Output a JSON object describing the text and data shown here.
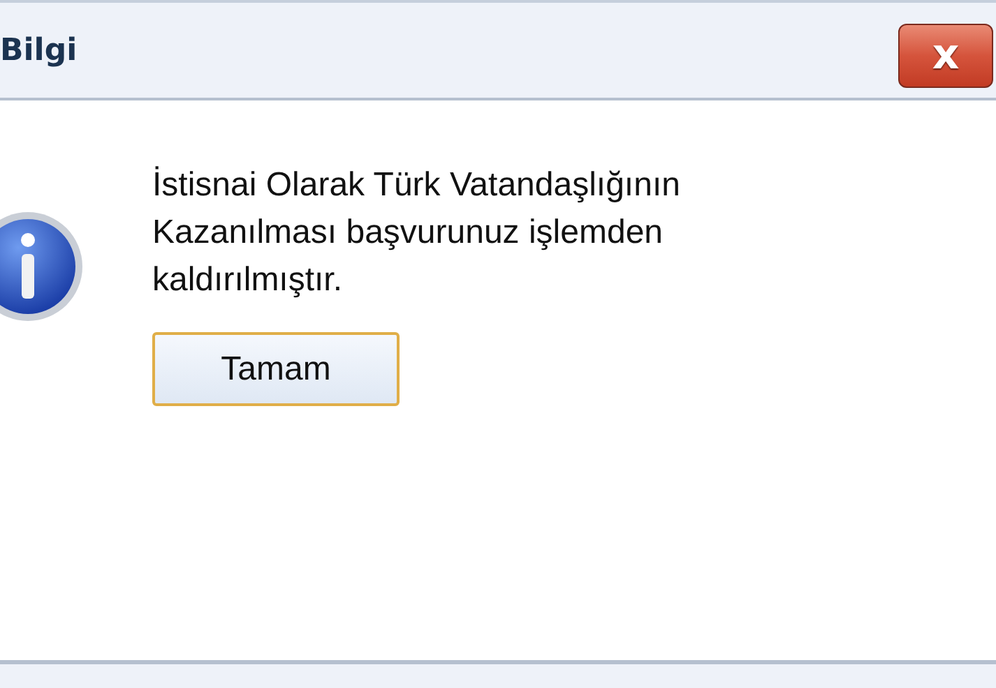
{
  "window": {
    "title": "Bilgi",
    "close_label": "x"
  },
  "message": "İstisnai Olarak Türk Vatandaşlığının Kazanılması başvurunuz işlemden kaldırılmıştır.",
  "buttons": [
    {
      "label": "Tamam"
    }
  ]
}
